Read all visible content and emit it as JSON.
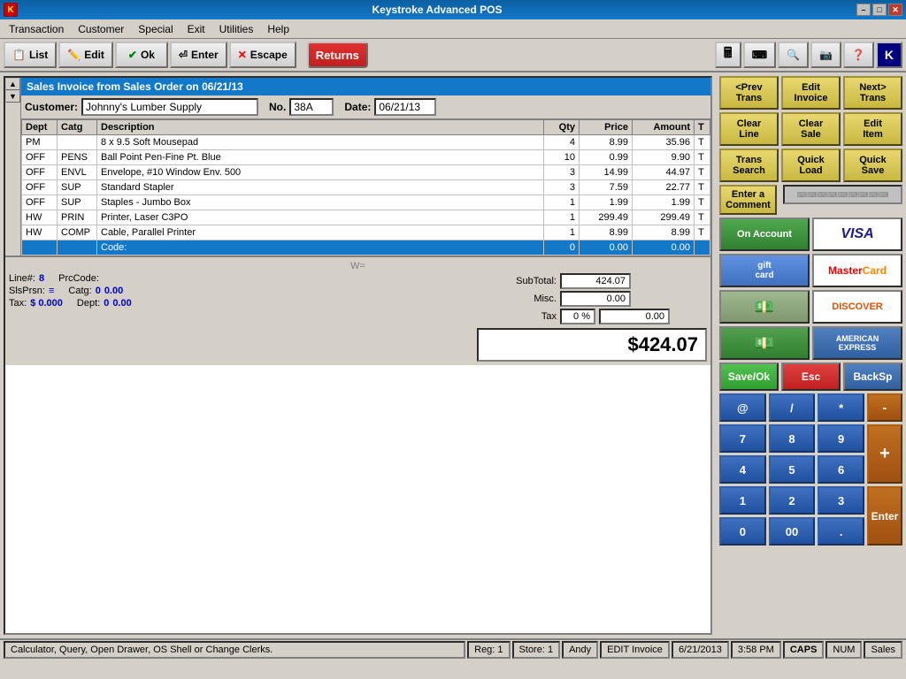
{
  "app": {
    "title": "Keystroke Advanced POS",
    "icon": "K"
  },
  "titlebar": {
    "minimize": "–",
    "restore": "□",
    "close": "✕"
  },
  "menubar": {
    "items": [
      {
        "label": "Transaction",
        "key": "T"
      },
      {
        "label": "Customer",
        "key": "C"
      },
      {
        "label": "Special",
        "key": "S"
      },
      {
        "label": "Exit",
        "key": "E"
      },
      {
        "label": "Utilities",
        "key": "U"
      },
      {
        "label": "Help",
        "key": "H"
      }
    ]
  },
  "toolbar": {
    "list_label": "List",
    "edit_label": "Edit",
    "ok_label": "Ok",
    "enter_label": "Enter",
    "escape_label": "Escape",
    "returns_label": "Returns"
  },
  "invoice": {
    "title": "Sales Invoice from Sales Order on 06/21/13",
    "customer_label": "Customer:",
    "customer_value": "Johnny's Lumber Supply",
    "no_label": "No.",
    "no_value": "38A",
    "date_label": "Date:",
    "date_value": "06/21/13",
    "columns": [
      "Dept",
      "Catg",
      "Description",
      "Qty",
      "Price",
      "Amount",
      "T"
    ],
    "rows": [
      {
        "dept": "PM",
        "catg": "",
        "desc": "8 x 9.5 Soft Mousepad",
        "qty": "4",
        "price": "8.99",
        "amount": "35.96",
        "t": "T"
      },
      {
        "dept": "OFF",
        "catg": "PENS",
        "desc": "Ball Point Pen-Fine Pt. Blue",
        "qty": "10",
        "price": "0.99",
        "amount": "9.90",
        "t": "T"
      },
      {
        "dept": "OFF",
        "catg": "ENVL",
        "desc": "Envelope, #10 Window Env. 500",
        "qty": "3",
        "price": "14.99",
        "amount": "44.97",
        "t": "T"
      },
      {
        "dept": "OFF",
        "catg": "SUP",
        "desc": "Standard Stapler",
        "qty": "3",
        "price": "7.59",
        "amount": "22.77",
        "t": "T"
      },
      {
        "dept": "OFF",
        "catg": "SUP",
        "desc": "Staples - Jumbo Box",
        "qty": "1",
        "price": "1.99",
        "amount": "1.99",
        "t": "T"
      },
      {
        "dept": "HW",
        "catg": "PRIN",
        "desc": "Printer, Laser C3PO",
        "qty": "1",
        "price": "299.49",
        "amount": "299.49",
        "t": "T"
      },
      {
        "dept": "HW",
        "catg": "COMP",
        "desc": "Cable, Parallel Printer",
        "qty": "1",
        "price": "8.99",
        "amount": "8.99",
        "t": "T"
      }
    ],
    "active_row": {
      "code_label": "Code:",
      "qty": "0",
      "price": "0.00",
      "amount": "0.00"
    },
    "bottom": {
      "line_label": "Line#:",
      "line_value": "8",
      "prccode_label": "PrcCode:",
      "slsprsn_label": "SlsPrsn:",
      "slsprsn_value": "≡",
      "catg_label": "Catg:",
      "catg_value": "0",
      "catg_amount": "0.00",
      "tax_label": "Tax:",
      "tax_value": "$ 0.000",
      "dept_label": "Dept:",
      "dept_value": "0",
      "dept_amount": "0.00",
      "w_label": "W="
    },
    "totals": {
      "subtotal_label": "SubTotal:",
      "subtotal_value": "424.07",
      "misc_label": "Misc.",
      "misc_value": "0.00",
      "tax_label": "Tax",
      "tax_pct": "0 %",
      "tax_value": "0.00",
      "grand_total": "$424.07"
    }
  },
  "right_panel": {
    "nav": {
      "prev_trans": "<Prev\nTrans",
      "edit_invoice": "Edit\nInvoice",
      "next_trans": "Next>\nTrans"
    },
    "actions": {
      "clear_line": "Clear\nLine",
      "clear_sale": "Clear\nSale",
      "edit_item": "Edit\nItem",
      "trans_search": "Trans\nSearch",
      "quick_load": "Quick\nLoad",
      "quick_save": "Quick\nSave"
    },
    "comment": "Enter a\nComment",
    "payments": {
      "on_account": "On Account",
      "visa": "VISA",
      "gift_card": "gift\ncard",
      "mastercard": "MasterCard",
      "check": "",
      "discover": "DISCOVER",
      "cash": "",
      "amex": "AMERICAN\nEXPRESS"
    },
    "calculator": {
      "save_ok": "Save/Ok",
      "esc": "Esc",
      "backsp": "BackSp",
      "at": "@",
      "div": "/",
      "mul": "*",
      "minus": "-",
      "n7": "7",
      "n8": "8",
      "n9": "9",
      "n4": "4",
      "n5": "5",
      "n6": "6",
      "n1": "1",
      "n2": "2",
      "n3": "3",
      "n0": "0",
      "n00": "00",
      "dot": ".",
      "plus": "+",
      "enter": "Enter"
    }
  },
  "statusbar": {
    "message": "Calculator, Query, Open Drawer, OS Shell or Change Clerks.",
    "reg": "Reg: 1",
    "store": "Store: 1",
    "clerk": "Andy",
    "mode": "EDIT Invoice",
    "date": "6/21/2013",
    "time": "3:58 PM",
    "caps": "CAPS",
    "num": "NUM",
    "sales": "Sales"
  }
}
